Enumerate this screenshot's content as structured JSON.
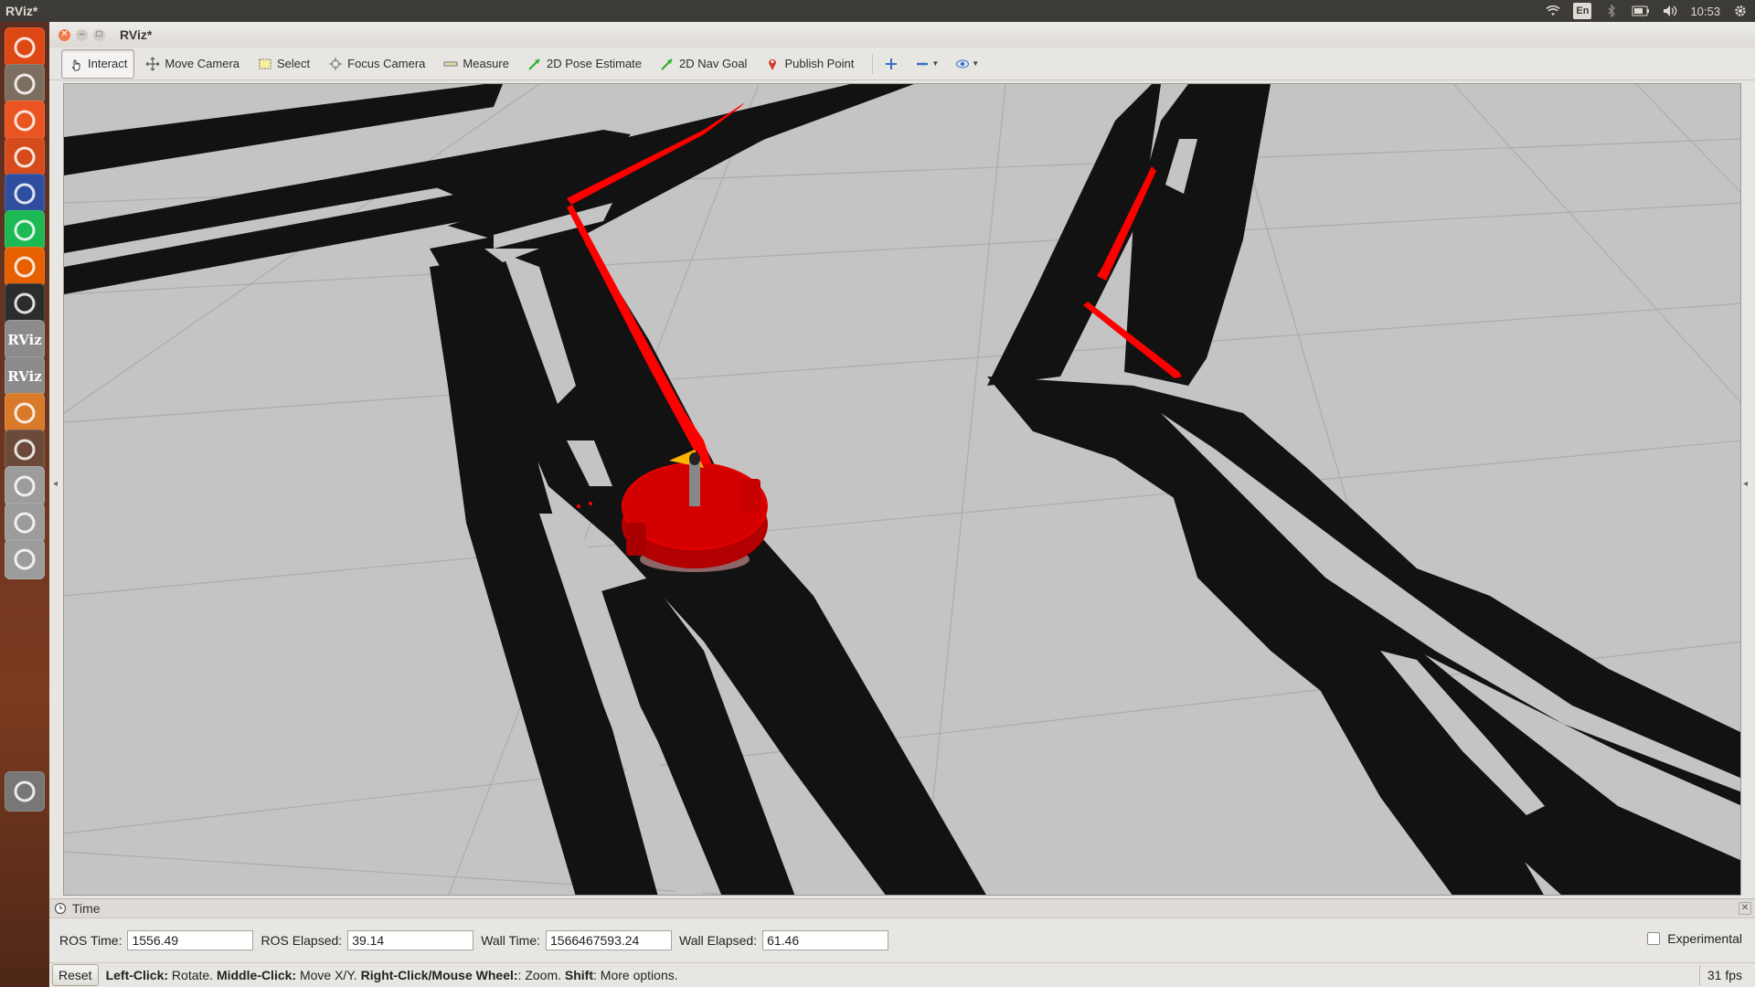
{
  "top_panel": {
    "title": "RViz*",
    "lang": "En",
    "clock": "10:53"
  },
  "launcher": {
    "items": [
      {
        "name": "ubuntu-dash-icon",
        "color": "#dd4814"
      },
      {
        "name": "files-icon",
        "color": "#7d6f5f"
      },
      {
        "name": "software-center-icon",
        "color": "#e95420"
      },
      {
        "name": "system-settings-icon",
        "color": "#d64b1b"
      },
      {
        "name": "texmaker-icon",
        "color": "#2f4ea0"
      },
      {
        "name": "spotify-icon",
        "color": "#1db954"
      },
      {
        "name": "firefox-icon",
        "color": "#e66000"
      },
      {
        "name": "terminal-icon",
        "color": "#2c2c2c"
      },
      {
        "name": "rviz-icon",
        "color": "#8b8b8b",
        "text": "RViz"
      },
      {
        "name": "rviz-icon-2",
        "color": "#8b8b8b",
        "text": "RViz"
      },
      {
        "name": "virtualbox-icon",
        "color": "#d87a2a"
      },
      {
        "name": "workspace-switcher-icon",
        "color": "#6b4a3a"
      },
      {
        "name": "drive-icon",
        "color": "#9c9c9c"
      },
      {
        "name": "drive-icon-2",
        "color": "#9c9c9c"
      },
      {
        "name": "drive-icon-3",
        "color": "#9c9c9c"
      },
      {
        "name": "trash-icon",
        "color": "#777"
      }
    ]
  },
  "window": {
    "title": "RViz*"
  },
  "toolbar": {
    "interact": "Interact",
    "move_camera": "Move Camera",
    "select": "Select",
    "focus_camera": "Focus Camera",
    "measure": "Measure",
    "pose_estimate": "2D Pose Estimate",
    "nav_goal": "2D Nav Goal",
    "publish_point": "Publish Point"
  },
  "viewport": {
    "background": "#c4c4c4",
    "obstacle_color": "#111111",
    "laser_color": "#ff0000",
    "robot_color": "#cc0000"
  },
  "time_panel": {
    "title": "Time",
    "ros_time_label": "ROS Time:",
    "ros_time": "1556.49",
    "ros_elapsed_label": "ROS Elapsed:",
    "ros_elapsed": "39.14",
    "wall_time_label": "Wall Time:",
    "wall_time": "1566467593.24",
    "wall_elapsed_label": "Wall Elapsed:",
    "wall_elapsed": "61.46",
    "experimental": "Experimental"
  },
  "statusbar": {
    "reset": "Reset",
    "help": [
      {
        "b": "Left-Click:",
        "t": " Rotate. "
      },
      {
        "b": "Middle-Click:",
        "t": " Move X/Y. "
      },
      {
        "b": "Right-Click/Mouse Wheel:",
        "t": ": Zoom. "
      },
      {
        "b": "Shift",
        "t": ": More options."
      }
    ],
    "fps": "31 fps"
  }
}
